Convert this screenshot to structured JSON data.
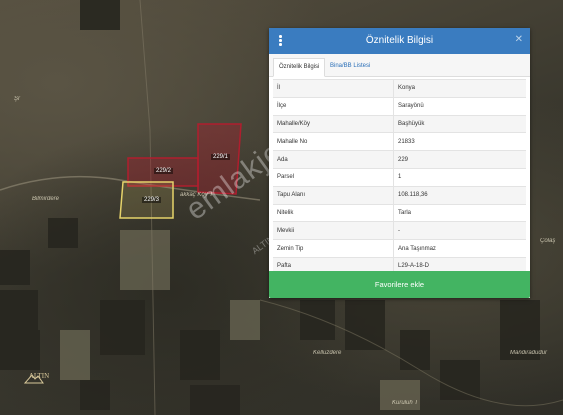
{
  "panel": {
    "title": "Öznitelik Bilgisi",
    "tabs": [
      "Öznitelik Bilgisi",
      "Bina/BB Listesi"
    ],
    "rows": [
      {
        "key": "İl",
        "value": "Konya"
      },
      {
        "key": "İlçe",
        "value": "Sarayönü"
      },
      {
        "key": "Mahalle/Köy",
        "value": "Başhüyük"
      },
      {
        "key": "Mahalle No",
        "value": "21833"
      },
      {
        "key": "Ada",
        "value": "229"
      },
      {
        "key": "Parsel",
        "value": "1"
      },
      {
        "key": "Tapu Alanı",
        "value": "108.118,36"
      },
      {
        "key": "Nitelik",
        "value": "Tarla"
      },
      {
        "key": "Mevkii",
        "value": "-"
      },
      {
        "key": "Zemin Tip",
        "value": "Ana Taşınmaz"
      },
      {
        "key": "Pafta",
        "value": "L29-A-18-D"
      }
    ],
    "button_label": "Favorilere ekle",
    "accent_color": "#3a7cc0",
    "button_color": "#43b462"
  },
  "map": {
    "labels": [
      "Şr",
      "Bilmirdere",
      "Kelluzdere",
      "Mandiradudur",
      "Çolaş",
      "Kuruluh T",
      "akkaç Köy T"
    ],
    "parcel_tags": [
      "229/1",
      "229/2",
      "229/3"
    ],
    "parcel_colors": {
      "selected": "#b01e2e",
      "neighbor": "#e6d36a"
    }
  },
  "watermark": {
    "main": "emlakjet.com",
    "sub": "ALTIN"
  },
  "logo": {
    "text": "ALTIN"
  }
}
